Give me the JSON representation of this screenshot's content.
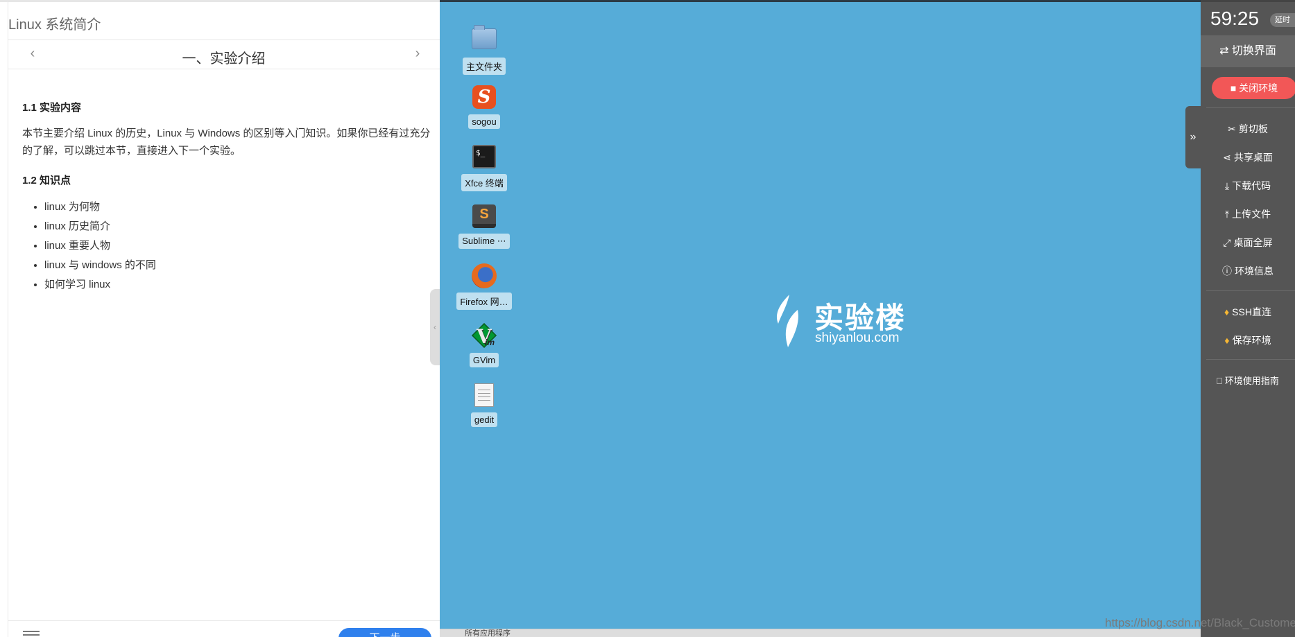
{
  "course": {
    "title": "Linux 系统简介"
  },
  "chapter_nav": {
    "prev_icon": "‹",
    "next_icon": "›",
    "title": "一、实验介绍"
  },
  "content": {
    "h1": "1.1 实验内容",
    "p1": "本节主要介绍 Linux 的历史，Linux 与 Windows 的区别等入门知识。如果你已经有过充分的了解，可以跳过本节，直接进入下一个实验。",
    "h2": "1.2 知识点",
    "points": [
      "linux 为何物",
      "linux 历史简介",
      "linux 重要人物",
      "linux 与 windows 的不同",
      "如何学习 linux"
    ]
  },
  "footer": {
    "next_label": "下一步"
  },
  "desktop": {
    "background": "#56acd8",
    "icons": [
      {
        "label": "主文件夹",
        "icon": "folder-home-icon"
      },
      {
        "label": "sogou",
        "icon": "sogou-icon"
      },
      {
        "label": "Xfce 终端",
        "icon": "terminal-icon"
      },
      {
        "label": "Sublime ⋯",
        "icon": "sublime-text-icon"
      },
      {
        "label": "Firefox 网…",
        "icon": "firefox-icon"
      },
      {
        "label": "GVim",
        "icon": "vim-icon"
      },
      {
        "label": "gedit",
        "icon": "gedit-icon"
      }
    ],
    "logo": {
      "cn": "实验楼",
      "en": "shiyanlou.com"
    },
    "taskbar_text": "所有应用程序"
  },
  "sidebar": {
    "timer": "59:25",
    "extend_label": "延时",
    "switch_label": "切换界面",
    "close_label": "关闭环境",
    "tools": [
      {
        "label": "剪切板",
        "icon": "scissors-icon",
        "glyph": "✂"
      },
      {
        "label": "共享桌面",
        "icon": "share-icon",
        "glyph": "⋖"
      },
      {
        "label": "下载代码",
        "icon": "download-icon",
        "glyph": "⤓"
      },
      {
        "label": "上传文件",
        "icon": "upload-icon",
        "glyph": "⤒"
      },
      {
        "label": "桌面全屏",
        "icon": "fullscreen-icon",
        "glyph": "⤢"
      },
      {
        "label": "环境信息",
        "icon": "info-icon",
        "glyph": "ⓘ"
      }
    ],
    "premium": [
      {
        "label": "SSH直连",
        "icon": "diamond-icon",
        "glyph": "♦"
      },
      {
        "label": "保存环境",
        "icon": "diamond-icon",
        "glyph": "♦"
      }
    ],
    "guide_label": "环境使用指南",
    "accent_close": "#f25757",
    "expand_icon": "»"
  },
  "watermark": "https://blog.csdn.net/Black_Customer"
}
